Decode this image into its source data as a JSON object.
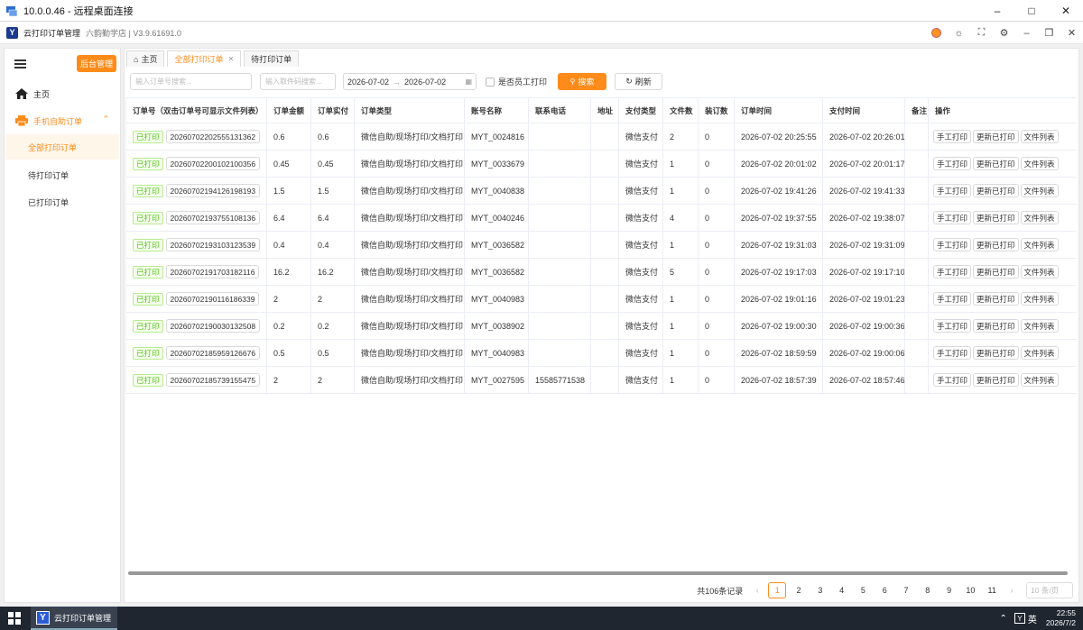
{
  "rdp": {
    "title": "10.0.0.46 - 远程桌面连接"
  },
  "app": {
    "name": "云打印订单管理",
    "shop": "六韵勤学店 | V3.9.61691.0"
  },
  "sidebar": {
    "admin_btn": "后台管理",
    "home": "主页",
    "group": "手机自助订单",
    "items": [
      "全部打印订单",
      "待打印订单",
      "已打印订单"
    ]
  },
  "tabs": [
    {
      "label": "主页"
    },
    {
      "label": "全部打印订单"
    },
    {
      "label": "待打印订单"
    }
  ],
  "filters": {
    "order_placeholder": "输入订单号搜索...",
    "code_placeholder": "输入取件码搜索...",
    "date_from": "2026-07-02",
    "date_to": "2026-07-02",
    "staff_print": "是否员工打印",
    "search": "搜索",
    "refresh": "刷新"
  },
  "table": {
    "headers": [
      "订单号（双击订单号可显示文件列表）",
      "订单金额",
      "订单实付",
      "订单类型",
      "账号名称",
      "联系电话",
      "地址",
      "支付类型",
      "文件数",
      "装订数",
      "订单时间",
      "支付时间",
      "备注",
      "操作"
    ],
    "status_label": "已打印",
    "actions": [
      "手工打印",
      "更新已打印",
      "文件列表"
    ],
    "rows": [
      {
        "order": "20260702202555131362",
        "amount": "0.6",
        "paid": "0.6",
        "type": "微信自助/现场打印/文档打印",
        "account": "MYT_0024816",
        "phone": "",
        "address": "",
        "pay_type": "微信支付",
        "files": "2",
        "binding": "0",
        "order_time": "2026-07-02 20:25:55",
        "pay_time": "2026-07-02 20:26:01",
        "note": ""
      },
      {
        "order": "20260702200102100356",
        "amount": "0.45",
        "paid": "0.45",
        "type": "微信自助/现场打印/文档打印",
        "account": "MYT_0033679",
        "phone": "",
        "address": "",
        "pay_type": "微信支付",
        "files": "1",
        "binding": "0",
        "order_time": "2026-07-02 20:01:02",
        "pay_time": "2026-07-02 20:01:17",
        "note": ""
      },
      {
        "order": "20260702194126198193",
        "amount": "1.5",
        "paid": "1.5",
        "type": "微信自助/现场打印/文档打印",
        "account": "MYT_0040838",
        "phone": "",
        "address": "",
        "pay_type": "微信支付",
        "files": "1",
        "binding": "0",
        "order_time": "2026-07-02 19:41:26",
        "pay_time": "2026-07-02 19:41:33",
        "note": ""
      },
      {
        "order": "20260702193755108136",
        "amount": "6.4",
        "paid": "6.4",
        "type": "微信自助/现场打印/文档打印",
        "account": "MYT_0040246",
        "phone": "",
        "address": "",
        "pay_type": "微信支付",
        "files": "4",
        "binding": "0",
        "order_time": "2026-07-02 19:37:55",
        "pay_time": "2026-07-02 19:38:07",
        "note": ""
      },
      {
        "order": "20260702193103123539",
        "amount": "0.4",
        "paid": "0.4",
        "type": "微信自助/现场打印/文档打印",
        "account": "MYT_0036582",
        "phone": "",
        "address": "",
        "pay_type": "微信支付",
        "files": "1",
        "binding": "0",
        "order_time": "2026-07-02 19:31:03",
        "pay_time": "2026-07-02 19:31:09",
        "note": ""
      },
      {
        "order": "20260702191703182116",
        "amount": "16.2",
        "paid": "16.2",
        "type": "微信自助/现场打印/文档打印",
        "account": "MYT_0036582",
        "phone": "",
        "address": "",
        "pay_type": "微信支付",
        "files": "5",
        "binding": "0",
        "order_time": "2026-07-02 19:17:03",
        "pay_time": "2026-07-02 19:17:10",
        "note": ""
      },
      {
        "order": "20260702190116186339",
        "amount": "2",
        "paid": "2",
        "type": "微信自助/现场打印/文档打印",
        "account": "MYT_0040983",
        "phone": "",
        "address": "",
        "pay_type": "微信支付",
        "files": "1",
        "binding": "0",
        "order_time": "2026-07-02 19:01:16",
        "pay_time": "2026-07-02 19:01:23",
        "note": ""
      },
      {
        "order": "20260702190030132508",
        "amount": "0.2",
        "paid": "0.2",
        "type": "微信自助/现场打印/文档打印",
        "account": "MYT_0038902",
        "phone": "",
        "address": "",
        "pay_type": "微信支付",
        "files": "1",
        "binding": "0",
        "order_time": "2026-07-02 19:00:30",
        "pay_time": "2026-07-02 19:00:36",
        "note": ""
      },
      {
        "order": "20260702185959126676",
        "amount": "0.5",
        "paid": "0.5",
        "type": "微信自助/现场打印/文档打印",
        "account": "MYT_0040983",
        "phone": "",
        "address": "",
        "pay_type": "微信支付",
        "files": "1",
        "binding": "0",
        "order_time": "2026-07-02 18:59:59",
        "pay_time": "2026-07-02 19:00:06",
        "note": ""
      },
      {
        "order": "20260702185739155475",
        "amount": "2",
        "paid": "2",
        "type": "微信自助/现场打印/文档打印",
        "account": "MYT_0027595",
        "phone": "15585771538",
        "address": "",
        "pay_type": "微信支付",
        "files": "1",
        "binding": "0",
        "order_time": "2026-07-02 18:57:39",
        "pay_time": "2026-07-02 18:57:46",
        "note": ""
      }
    ]
  },
  "pager": {
    "total": "共106条记录",
    "pages": [
      "1",
      "2",
      "3",
      "4",
      "5",
      "6",
      "7",
      "8",
      "9",
      "10",
      "11"
    ],
    "current": "1",
    "size": "10 条/页"
  },
  "taskbar": {
    "app": "云打印订单管理",
    "ime": "英",
    "time": "22:55",
    "date": "2026/7/2"
  },
  "colors": {
    "accent": "#ff8c1a",
    "printed_tag": "#52c41a"
  }
}
